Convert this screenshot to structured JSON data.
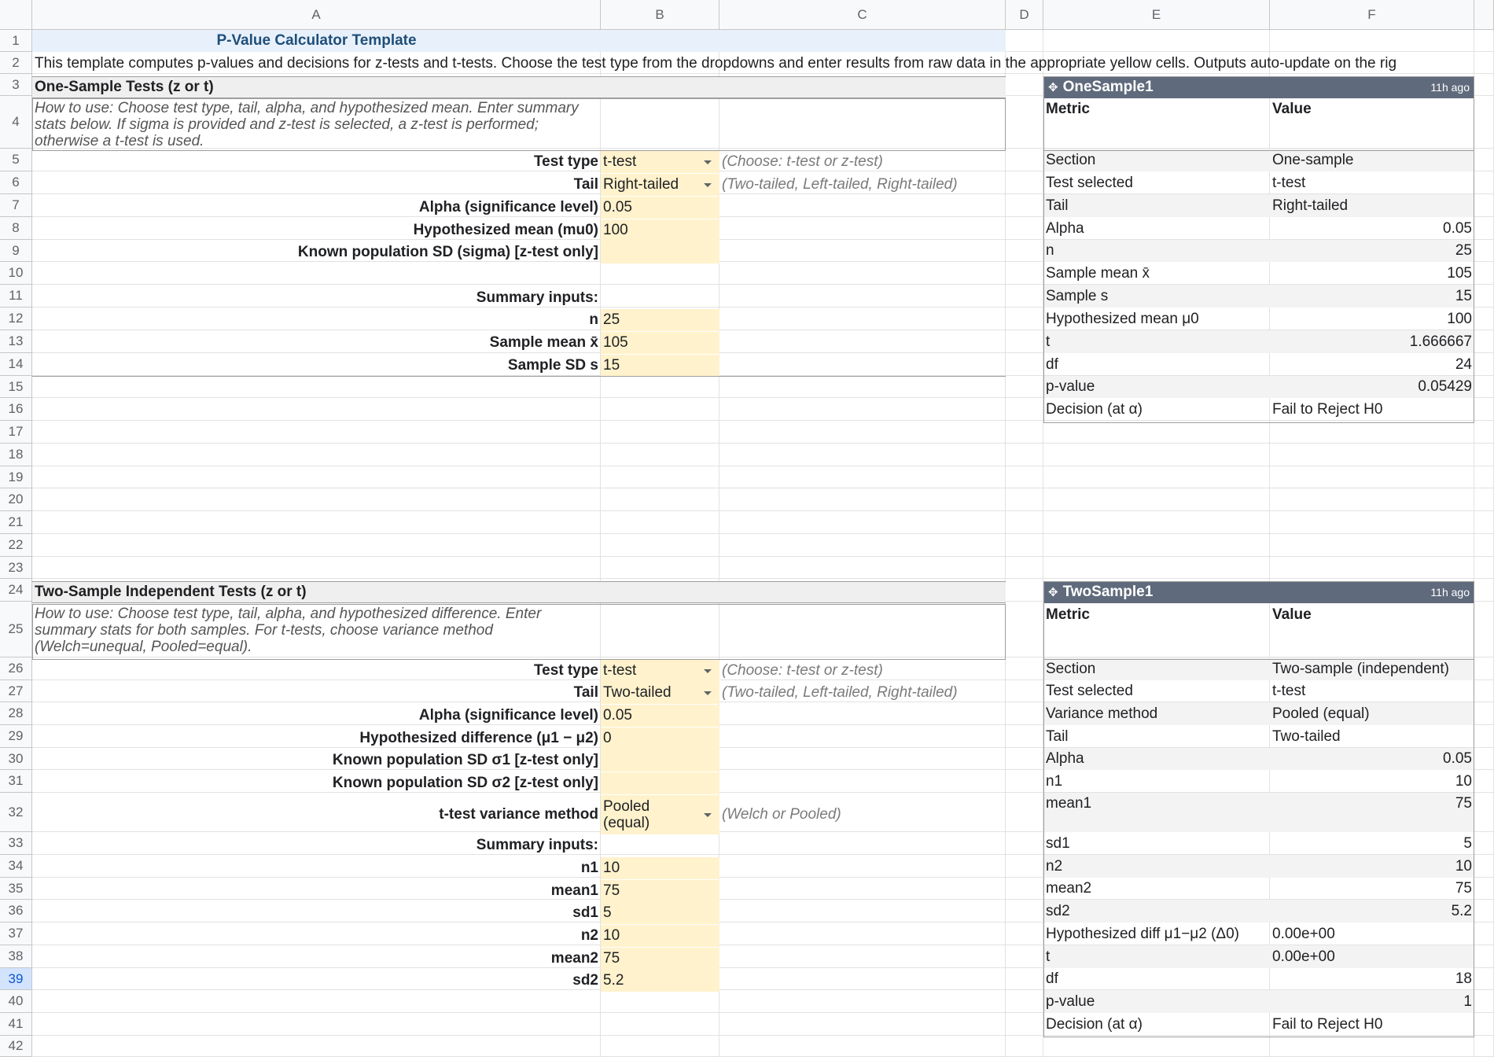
{
  "columns": [
    "A",
    "B",
    "C",
    "D",
    "E",
    "F"
  ],
  "rows": [
    "1",
    "2",
    "3",
    "4",
    "5",
    "6",
    "7",
    "8",
    "9",
    "10",
    "11",
    "12",
    "13",
    "14",
    "15",
    "16",
    "17",
    "18",
    "19",
    "20",
    "21",
    "22",
    "23",
    "24",
    "25",
    "26",
    "27",
    "28",
    "29",
    "30",
    "31",
    "32",
    "33",
    "34",
    "35",
    "36",
    "37",
    "38",
    "39",
    "40",
    "41",
    "42"
  ],
  "selected_row": "39",
  "title": "P-Value Calculator Template",
  "intro": "This template computes p-values and decisions for z-tests and t-tests. Choose the test type from the dropdowns and enter results from raw data in the appropriate yellow cells. Outputs auto-update on the rig",
  "one_sample": {
    "header": "One-Sample Tests (z or t)",
    "howto": "How to use: Choose test type, tail, alpha, and hypothesized mean. Enter summary stats below. If sigma is provided and z-test is selected, a z-test is performed; otherwise a t-test is used.",
    "test_type_label": "Test type",
    "test_type_value": "t-test",
    "test_type_note": "(Choose: t-test or z-test)",
    "tail_label": "Tail",
    "tail_value": "Right-tailed",
    "tail_note": "(Two-tailed, Left-tailed, Right-tailed)",
    "alpha_label": "Alpha (significance level)",
    "alpha_value": "0.05",
    "mu0_label": "Hypothesized mean (mu0)",
    "mu0_value": "100",
    "sigma_label": "Known population SD (sigma) [z-test only]",
    "sigma_value": "",
    "summary_label": "Summary inputs:",
    "n_label": "n",
    "n_value": "25",
    "mean_label": "Sample mean x̄",
    "mean_value": "105",
    "sd_label": "Sample SD s",
    "sd_value": "15"
  },
  "one_sample_table": {
    "name": "OneSample1",
    "updated": "11h ago",
    "col_metric": "Metric",
    "col_value": "Value",
    "rows": [
      {
        "metric": "Section",
        "value": "One-sample",
        "align": "left"
      },
      {
        "metric": "Test selected",
        "value": "t-test",
        "align": "left"
      },
      {
        "metric": "Tail",
        "value": "Right-tailed",
        "align": "left"
      },
      {
        "metric": "Alpha",
        "value": "0.05",
        "align": "right"
      },
      {
        "metric": "n",
        "value": "25",
        "align": "right"
      },
      {
        "metric": "Sample mean x̄",
        "value": "105",
        "align": "right"
      },
      {
        "metric": "Sample s",
        "value": "15",
        "align": "right"
      },
      {
        "metric": "Hypothesized mean μ0",
        "value": "100",
        "align": "right"
      },
      {
        "metric": "t",
        "value": "1.666667",
        "align": "right"
      },
      {
        "metric": "df",
        "value": "24",
        "align": "right"
      },
      {
        "metric": "p-value",
        "value": "0.05429",
        "align": "right"
      },
      {
        "metric": "Decision (at α)",
        "value": "Fail to Reject H0",
        "align": "left"
      }
    ]
  },
  "two_sample": {
    "header": "Two-Sample Independent Tests (z or t)",
    "howto": "How to use: Choose test type, tail, alpha, and hypothesized difference. Enter summary stats for both samples. For t-tests, choose variance method (Welch=unequal, Pooled=equal).",
    "test_type_label": "Test type",
    "test_type_value": "t-test",
    "test_type_note": "(Choose: t-test or z-test)",
    "tail_label": "Tail",
    "tail_value": "Two-tailed",
    "tail_note": "(Two-tailed, Left-tailed, Right-tailed)",
    "alpha_label": "Alpha (significance level)",
    "alpha_value": "0.05",
    "diff_label": "Hypothesized difference (μ1 − μ2)",
    "diff_value": "0",
    "sigma1_label": "Known population SD σ1 [z-test only]",
    "sigma1_value": "",
    "sigma2_label": "Known population SD σ2 [z-test only]",
    "sigma2_value": "",
    "variance_label": "t-test variance method",
    "variance_value": "Pooled (equal)",
    "variance_note": "(Welch or Pooled)",
    "summary_label": "Summary inputs:",
    "n1_label": "n1",
    "n1_value": "10",
    "mean1_label": "mean1",
    "mean1_value": "75",
    "sd1_label": "sd1",
    "sd1_value": "5",
    "n2_label": "n2",
    "n2_value": "10",
    "mean2_label": "mean2",
    "mean2_value": "75",
    "sd2_label": "sd2",
    "sd2_value": "5.2"
  },
  "two_sample_table": {
    "name": "TwoSample1",
    "updated": "11h ago",
    "col_metric": "Metric",
    "col_value": "Value",
    "rows": [
      {
        "metric": "Section",
        "value": "Two-sample (independent)",
        "align": "left"
      },
      {
        "metric": "Test selected",
        "value": "t-test",
        "align": "left"
      },
      {
        "metric": "Variance method",
        "value": "Pooled (equal)",
        "align": "left"
      },
      {
        "metric": "Tail",
        "value": "Two-tailed",
        "align": "left"
      },
      {
        "metric": "Alpha",
        "value": "0.05",
        "align": "right"
      },
      {
        "metric": "n1",
        "value": "10",
        "align": "right"
      },
      {
        "metric": "mean1",
        "value": "75",
        "align": "right"
      },
      {
        "metric": "sd1",
        "value": "5",
        "align": "right"
      },
      {
        "metric": "n2",
        "value": "10",
        "align": "right"
      },
      {
        "metric": "mean2",
        "value": "75",
        "align": "right"
      },
      {
        "metric": "sd2",
        "value": "5.2",
        "align": "right"
      },
      {
        "metric": "Hypothesized diff μ1−μ2 (Δ0)",
        "value": "0.00e+00",
        "align": "left"
      },
      {
        "metric": "t",
        "value": "0.00e+00",
        "align": "left"
      },
      {
        "metric": "df",
        "value": "18",
        "align": "right"
      },
      {
        "metric": "p-value",
        "value": "1",
        "align": "right"
      },
      {
        "metric": "Decision (at α)",
        "value": "Fail to Reject H0",
        "align": "left"
      }
    ]
  },
  "colors": {
    "input_yellow": "#fff2cc",
    "title_blue": "#1f4e79",
    "table_header": "#5f6b7c",
    "selection": "#d3e3fd"
  },
  "icons": [
    "dropdown-arrow-icon",
    "table-icon"
  ]
}
